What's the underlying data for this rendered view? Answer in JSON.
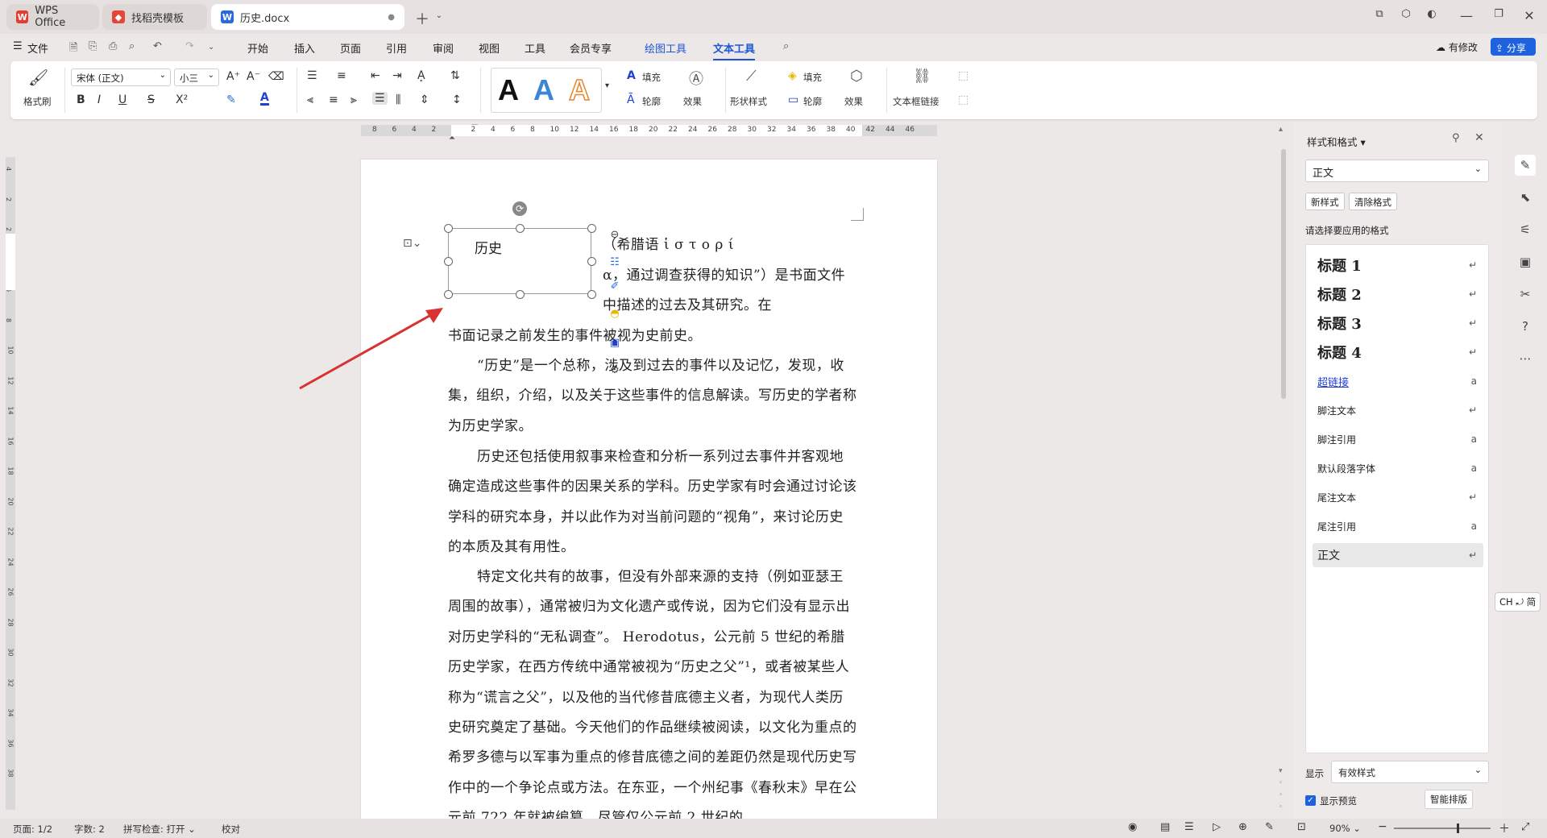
{
  "tabs": [
    {
      "label": "WPS Office"
    },
    {
      "label": "找稻壳模板"
    },
    {
      "label": "历史.docx"
    }
  ],
  "menu": {
    "file": "文件",
    "items": [
      "开始",
      "插入",
      "页面",
      "引用",
      "审阅",
      "视图",
      "工具",
      "会员专享",
      "绘图工具",
      "文本工具"
    ],
    "right_modified": "有修改",
    "right_share": "分享"
  },
  "ribbon": {
    "format_painter": "格式刷",
    "font_name": "宋体 (正文)",
    "font_size": "小三",
    "fill_label": "填充",
    "outline_label": "轮廓",
    "effect_label": "效果",
    "shape_style": "形状样式",
    "shape_fill": "填充",
    "shape_outline": "轮廓",
    "shape_effect": "效果",
    "textbox_link": "文本框链接"
  },
  "ruler_numbers": [
    "8",
    "6",
    "4",
    "2",
    "",
    "2",
    "4",
    "6",
    "8",
    "10",
    "12",
    "14",
    "16",
    "18",
    "20",
    "22",
    "24",
    "26",
    "28",
    "30",
    "32",
    "34",
    "36",
    "38",
    "40",
    "42",
    "44",
    "46"
  ],
  "vruler_numbers": [
    "4",
    "2",
    "2",
    "4",
    "6",
    "8",
    "10",
    "12",
    "14",
    "16",
    "18",
    "20",
    "22",
    "24",
    "26",
    "28",
    "30",
    "32",
    "34",
    "36",
    "38"
  ],
  "document": {
    "textbox_text": "历史",
    "paragraphs": [
      "（希腊语 ἱ σ τ ο ρ ί α，通过调查获得的知识”）是书面文件中描述的过去及其研究。在书面记录之前发生的事件被视为史前史。",
      "“历史”是一个总称，涉及到过去的事件以及记忆，发现，收集，组织，介绍，以及关于这些事件的信息解读。写历史的学者称为历史学家。",
      "历史还包括使用叙事来检查和分析一系列过去事件并客观地确定造成这些事件的因果关系的学科。历史学家有时会通过讨论该学科的研究本身，并以此作为对当前问题的“视角”，来讨论历史的本质及其有用性。",
      "特定文化共有的故事，但没有外部来源的支持（例如亚瑟王周围的故事），通常被归为文化遗产或传说，因为它们没有显示出对历史学科的“无私调查”。 Herodotus，公元前 5 世纪的希腊历史学家，在西方传统中通常被视为“历史之父”¹，或者被某些人称为“谎言之父”，以及他的当代修昔底德主义者，为现代人类历史研究奠定了基础。今天他们的作品继续被阅读，以文化为重点的希罗多德与以军事为重点的修昔底德之间的差距仍然是现代历史写作中的一个争论点或方法。在东亚，一个州纪事《春秋末》早在公元前 722 年就被编篡，尽管仅公元前 2 世纪的"
    ]
  },
  "style_panel": {
    "title": "样式和格式",
    "current_style": "正文",
    "new_style": "新样式",
    "clear_format": "清除格式",
    "prompt": "请选择要应用的格式",
    "styles": [
      {
        "label": "标题  1",
        "kind": "heading"
      },
      {
        "label": "标题  2",
        "kind": "heading"
      },
      {
        "label": "标题  3",
        "kind": "heading"
      },
      {
        "label": "标题  4",
        "kind": "heading"
      },
      {
        "label": "超链接",
        "kind": "link"
      },
      {
        "label": "脚注文本",
        "kind": "normal"
      },
      {
        "label": "脚注引用",
        "kind": "normal"
      },
      {
        "label": "默认段落字体",
        "kind": "normal"
      },
      {
        "label": "尾注文本",
        "kind": "normal"
      },
      {
        "label": "尾注引用",
        "kind": "normal"
      },
      {
        "label": "正文",
        "kind": "selected"
      }
    ],
    "show_label": "显示",
    "show_value": "有效样式",
    "preview_label": "显示预览",
    "smart_layout": "智能排版"
  },
  "ime_indicator": "CH ⤾ 简",
  "status": {
    "page": "页面: 1/2",
    "words": "字数: 2",
    "spell": "拼写检查: 打开",
    "proof": "校对",
    "zoom": "90%"
  },
  "colors": {
    "accent": "#1f56d6",
    "wps_red": "#e43b32",
    "arrow_red": "#d93232"
  }
}
